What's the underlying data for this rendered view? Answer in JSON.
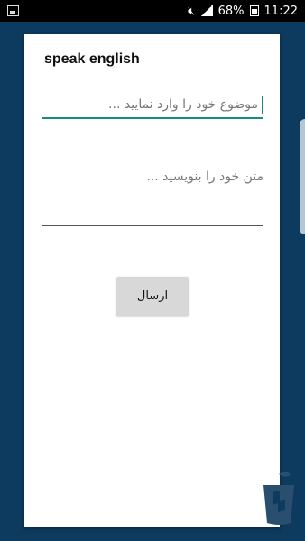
{
  "status_bar": {
    "battery": "68%",
    "time": "11:22",
    "icons": [
      "image-icon",
      "mute-icon",
      "signal-icon",
      "battery-icon"
    ]
  },
  "dialog": {
    "title": "speak english",
    "subject_placeholder": "موضوع خود را وارد نمایید ...",
    "text_placeholder": "متن خود را بنویسید ...",
    "send_label": "ارسال"
  },
  "colors": {
    "background": "#0d3a5f",
    "accent": "#1b8a7c",
    "button": "#d8d8d8"
  }
}
